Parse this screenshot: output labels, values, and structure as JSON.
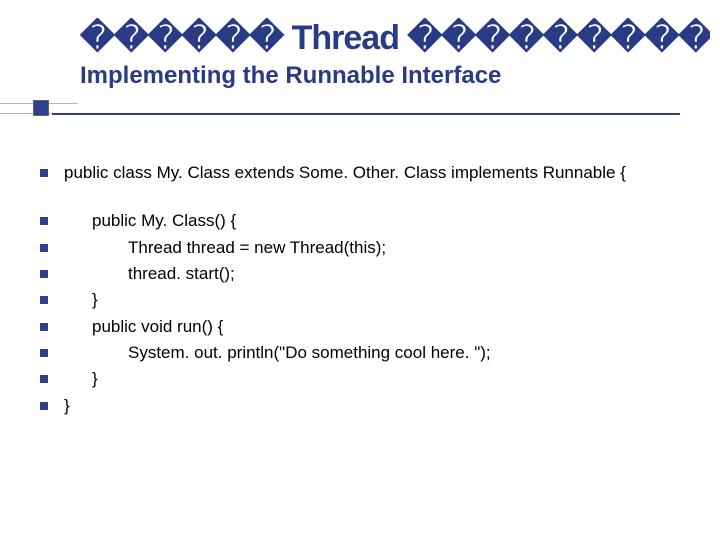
{
  "title": {
    "line1": "������ Thread ���������",
    "line2": "Implementing the Runnable Interface"
  },
  "code": {
    "l0": "public class My. Class extends Some. Other. Class implements Runnable {",
    "l1": "public My. Class() {",
    "l2": "Thread thread = new Thread(this);",
    "l3": "thread. start();",
    "l4": "}",
    "l5": "public void run() {",
    "l6": "System. out. println(\"Do something cool here. \");",
    "l7": "}",
    "l8": "}"
  }
}
